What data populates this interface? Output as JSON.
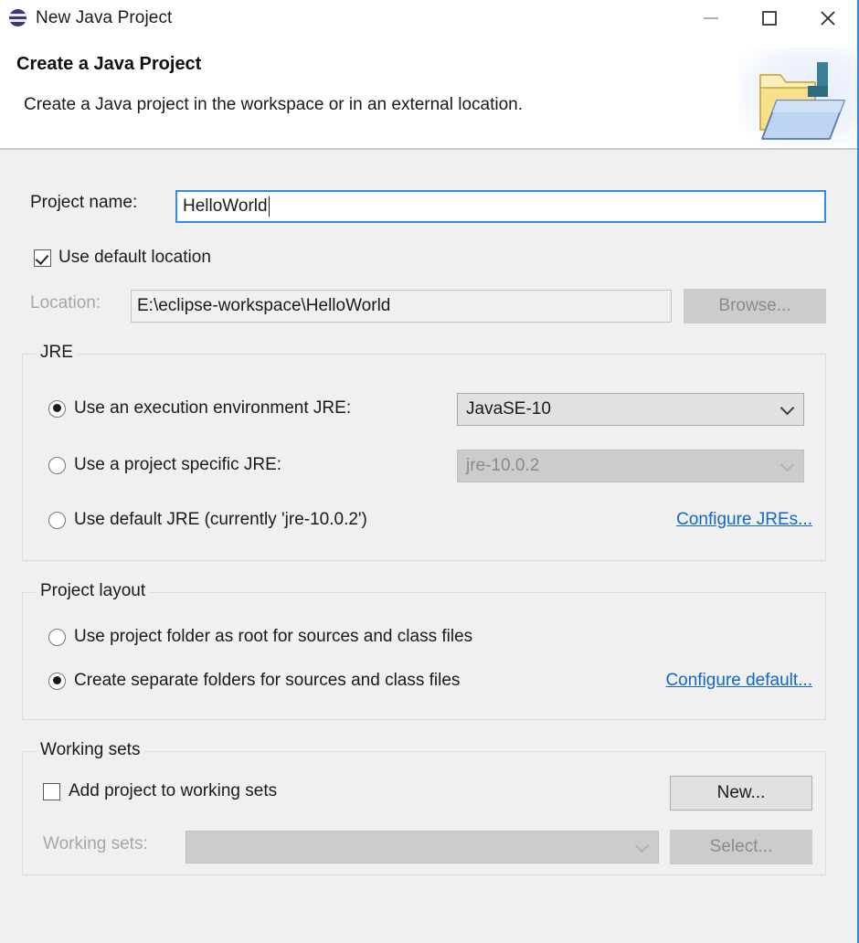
{
  "window": {
    "title": "New Java Project",
    "icon": "eclipse-logo-icon",
    "buttons": {
      "minimize": "minimize-icon",
      "maximize": "maximize-icon",
      "close": "close-icon"
    }
  },
  "header": {
    "title": "Create a Java Project",
    "description": "Create a Java project in the workspace or in an external location.",
    "banner_icon": "java-project-folder-icon"
  },
  "project_name": {
    "label": "Project name:",
    "value": "HelloWorld",
    "placeholder": ""
  },
  "location": {
    "use_default_checkbox": {
      "label": "Use default location",
      "checked": true
    },
    "label": "Location:",
    "value": "E:\\eclipse-workspace\\HelloWorld",
    "browse_button": "Browse...",
    "disabled": true
  },
  "jre": {
    "group_title": "JRE",
    "options": [
      {
        "label": "Use an execution environment JRE:",
        "selected": true,
        "combo_value": "JavaSE-10",
        "combo_disabled": false
      },
      {
        "label": "Use a project specific JRE:",
        "selected": false,
        "combo_value": "jre-10.0.2",
        "combo_disabled": true
      },
      {
        "label": "Use default JRE (currently 'jre-10.0.2')",
        "selected": false
      }
    ],
    "configure_link": "Configure JREs..."
  },
  "project_layout": {
    "group_title": "Project layout",
    "options": [
      {
        "label": "Use project folder as root for sources and class files",
        "selected": false
      },
      {
        "label": "Create separate folders for sources and class files",
        "selected": true
      }
    ],
    "configure_link": "Configure default..."
  },
  "working_sets": {
    "group_title": "Working sets",
    "add_checkbox": {
      "label": "Add project to working sets",
      "checked": false
    },
    "new_button": "New...",
    "label": "Working sets:",
    "value": "",
    "select_button": "Select...",
    "disabled": true
  },
  "colors": {
    "accent_blue": "#2f8de4",
    "link_blue": "#1166cc",
    "background": "#f0f0f0",
    "header_background": "#ffffff",
    "disabled_grey": "#cccccc"
  }
}
